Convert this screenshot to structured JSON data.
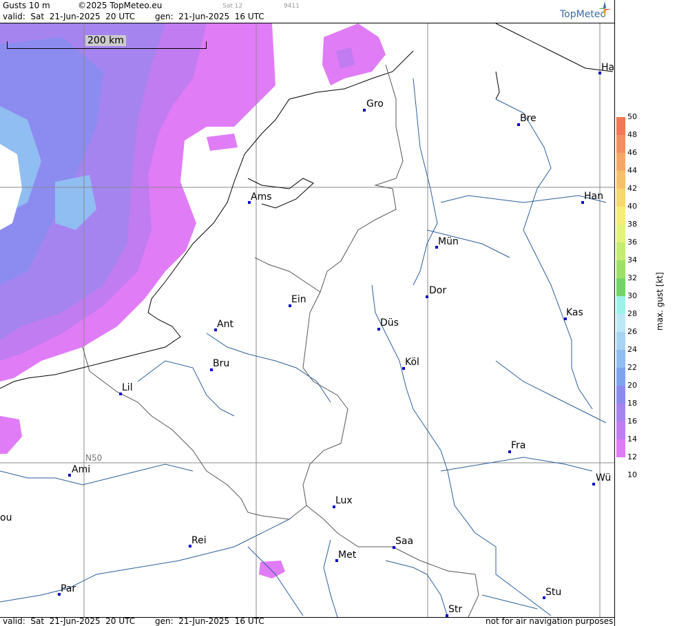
{
  "header": {
    "product": "Gusts 10 m",
    "copyright": "©2025 TopMeteo.eu",
    "run_tag": "Sat 12",
    "code": "9411",
    "valid": "valid:  Sat  21-Jun-2025  20 UTC",
    "gen": "gen:  21-Jun-2025  16 UTC",
    "logo": "TopMeteo"
  },
  "footer": {
    "valid": "valid:  Sat  21-Jun-2025  20 UTC",
    "gen": "gen:  21-Jun-2025  16 UTC",
    "note": "not for air navigation purposes"
  },
  "map": {
    "scale_label": "200 km",
    "lat_label": "N50",
    "cities": [
      "Ha",
      "Gro",
      "Bre",
      "Ams",
      "Han",
      "Mün",
      "Dor",
      "Ein",
      "Kas",
      "Ant",
      "Düs",
      "Köl",
      "Bru",
      "Lil",
      "Fra",
      "Ami",
      "Wü",
      "Lux",
      "ou",
      "Saa",
      "Rei",
      "Met",
      "Stu",
      "Par",
      "Str"
    ]
  },
  "legend": {
    "title": "max. gust [kt]",
    "ticks": [
      "50",
      "48",
      "46",
      "44",
      "42",
      "40",
      "38",
      "36",
      "34",
      "32",
      "30",
      "28",
      "26",
      "24",
      "22",
      "20",
      "18",
      "16",
      "14",
      "12",
      "10"
    ],
    "colors": [
      "#f07856",
      "#f39060",
      "#f5a866",
      "#f6c06a",
      "#f7d870",
      "#f5ee78",
      "#e2f27a",
      "#c4ec70",
      "#9ee066",
      "#72d468",
      "#9cf2e8",
      "#bde8f5",
      "#a8d4f4",
      "#90bdf2",
      "#7ea6f0",
      "#8c8cf0",
      "#a584f0",
      "#c07cf0",
      "#e07cf6"
    ]
  }
}
